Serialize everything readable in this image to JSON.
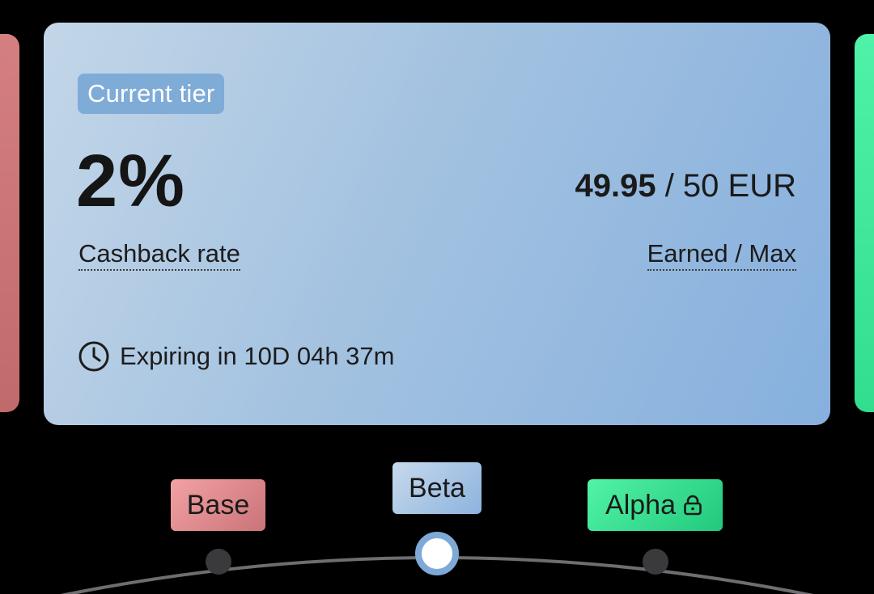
{
  "card": {
    "badge": "Current tier",
    "rate_value": "2%",
    "rate_label": "Cashback rate",
    "earned_amount": "49.95",
    "earned_suffix": " / 50 EUR",
    "earned_label": "Earned / Max",
    "expiry_text": "Expiring in 10D 04h 37m"
  },
  "tiers": [
    {
      "label": "Base",
      "state": "previous",
      "color": "#e98f93"
    },
    {
      "label": "Beta",
      "state": "current",
      "color": "#a9c6e6"
    },
    {
      "label": "Alpha",
      "state": "locked",
      "color": "#3ee897"
    }
  ],
  "icons": {
    "clock": "clock-icon",
    "lock": "lock-icon"
  },
  "colors": {
    "background": "#000000",
    "card_gradient_start": "#c3d6e8",
    "card_gradient_end": "#86b0de",
    "badge": "#7fabd7",
    "track": "#808080",
    "node_inactive": "#3a3a3c",
    "node_active_ring": "#7ea9d6"
  }
}
